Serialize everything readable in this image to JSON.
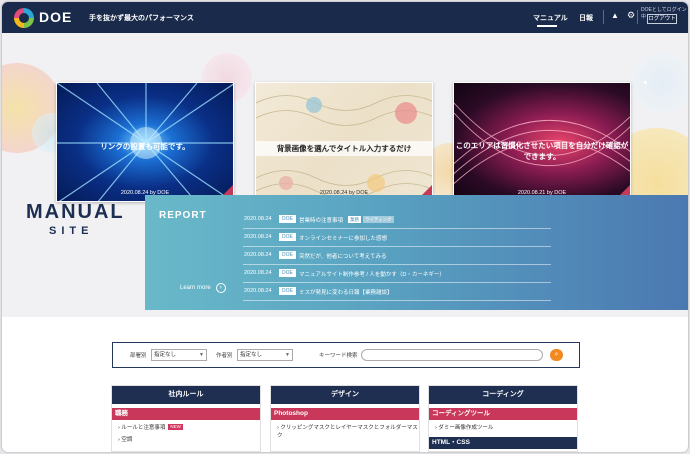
{
  "header": {
    "brand": "DOE",
    "tagline": "手を抜かず最大のパフォーマンス",
    "nav": {
      "manual": "マニュアル",
      "diary": "日報"
    },
    "login_status": "DOEとしてログイン中",
    "logout_label": "ログアウト"
  },
  "hero": {
    "title": "MANUAL",
    "subtitle": "SITE",
    "slides": [
      {
        "caption": "リンクの設置も可能です。",
        "date": "2020.08.24",
        "author": "by DOE"
      },
      {
        "caption": "背景画像を選んでタイトル入力するだけ",
        "date": "2020.08.24",
        "author": "by DOE"
      },
      {
        "caption_lines": [
          "このエリアは習慣化させたい項目を自分だけ確認が",
          "できます。"
        ],
        "date": "2020.08.21",
        "author": "by DOE"
      }
    ]
  },
  "report": {
    "title": "REPORT",
    "learn_more": "Learn more",
    "items": [
      {
        "date": "2020.08.24",
        "tag": "DOE",
        "text": "営業時の注意事項",
        "badges": [
          "業務",
          "ライティング"
        ]
      },
      {
        "date": "2020.08.24",
        "tag": "DOE",
        "text": "オンラインセミナーに参加した感想",
        "badges": []
      },
      {
        "date": "2020.08.24",
        "tag": "DOE",
        "text": "突然だが、他者について考えてみる",
        "badges": []
      },
      {
        "date": "2020.08.24",
        "tag": "DOE",
        "text": "マニュアルサイト制作参考 / 人を動かす（D・カーネギー）",
        "badges": []
      },
      {
        "date": "2020.08.24",
        "tag": "DOE",
        "text": "ミスが発見に変わる日報【業務雑談】",
        "badges": []
      }
    ]
  },
  "search": {
    "dept_label": "部署別",
    "dept_value": "指定なし",
    "type_label": "作者別",
    "type_value": "指定なし",
    "keyword_label": "キーワード検索",
    "keyword_placeholder": ""
  },
  "columns": [
    {
      "title": "社内ルール",
      "sub": "職務",
      "items": [
        {
          "label": "ルールと注意事項",
          "new": "NEW"
        },
        {
          "label": "空調",
          "new": ""
        }
      ],
      "sub2": ""
    },
    {
      "title": "デザイン",
      "sub": "Photoshop",
      "items": [
        {
          "label": "クリッピングマスクとレイヤーマスクとフォルダーマスク",
          "new": ""
        }
      ],
      "sub2": ""
    },
    {
      "title": "コーディング",
      "sub": "コーディングツール",
      "items": [
        {
          "label": "ダミー画像作成ツール",
          "new": ""
        }
      ],
      "sub2": "HTML・CSS"
    }
  ],
  "colors": {
    "navy": "#1a2a4a",
    "accent_red": "#c9385a",
    "report_start": "#69b9c9",
    "report_end": "#4b78b1",
    "search_button": "#f08a20"
  }
}
